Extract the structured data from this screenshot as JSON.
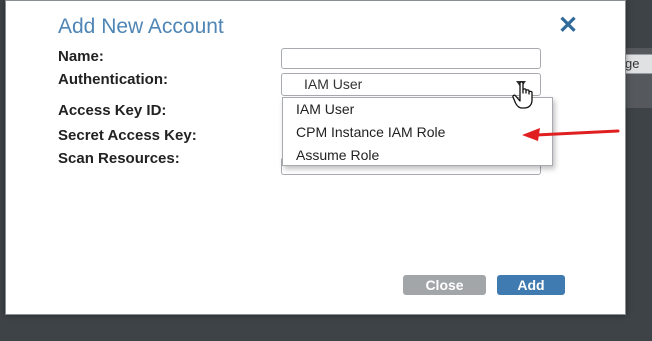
{
  "background": {
    "fragment_text": "ge"
  },
  "dialog": {
    "title": "Add New Account",
    "close_icon": "close-icon",
    "labels": {
      "name": "Name:",
      "authentication": "Authentication:",
      "access_key_id": "Access Key ID:",
      "secret_access_key": "Secret Access Key:",
      "scan_resources": "Scan Resources:"
    },
    "name_value": "",
    "authentication_selected": "IAM User",
    "authentication_options": [
      "IAM User",
      "CPM Instance IAM Role",
      "Assume Role"
    ],
    "buttons": {
      "close": "Close",
      "add": "Add"
    }
  },
  "colors": {
    "title": "#4f86b5",
    "close_icon": "#2f6a9a",
    "add_button": "#3f7ab0",
    "close_button": "#a3a6a9",
    "annotation_arrow": "#e02020"
  }
}
